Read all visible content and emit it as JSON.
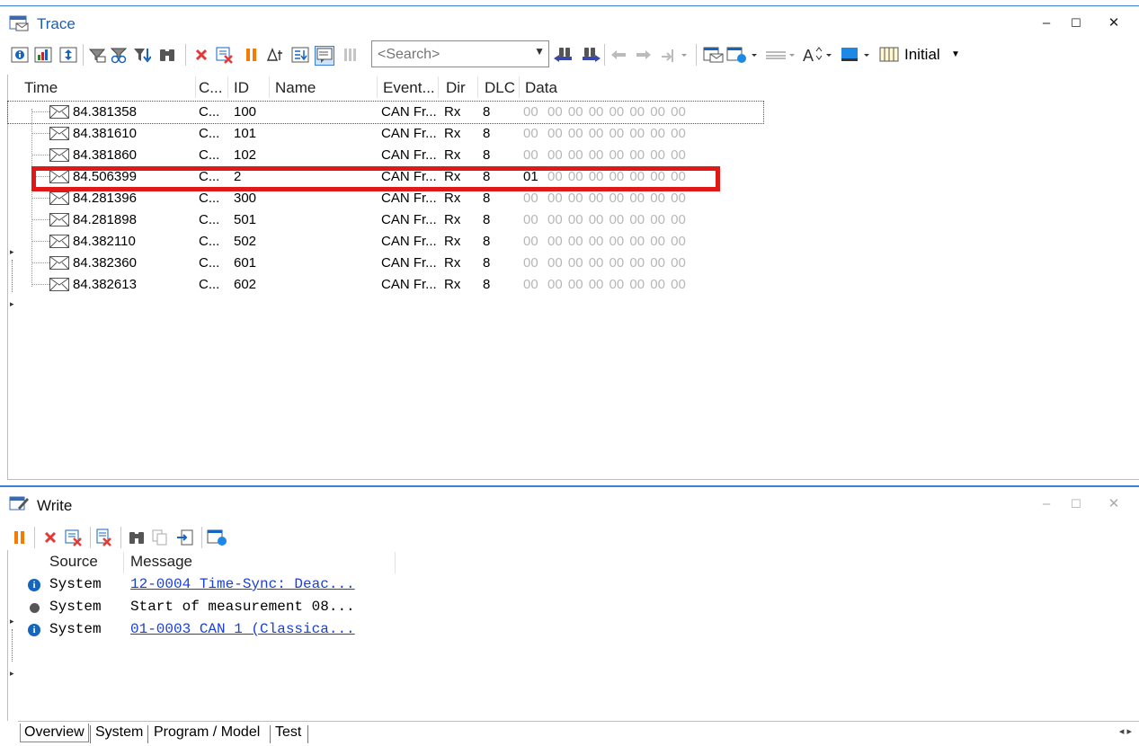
{
  "trace": {
    "title": "Trace",
    "window_controls": {
      "minimize": "–",
      "maximize": "☐",
      "close": "✕"
    },
    "search": {
      "placeholder": "<Search>"
    },
    "view": {
      "label": "Initial"
    },
    "columns": [
      "Time",
      "C...",
      "ID",
      "Name",
      "Event...",
      "Dir",
      "DLC",
      "Data"
    ],
    "rows": [
      {
        "time": "84.381358",
        "chan": "C...",
        "id": "100",
        "name": "",
        "event": "CAN Fr...",
        "dir": "Rx",
        "dlc": "8",
        "first": "00",
        "data": "00  00  00  00  00  00  00  00",
        "rest": "00  00  00  00  00  00  00"
      },
      {
        "time": "84.381610",
        "chan": "C...",
        "id": "101",
        "name": "",
        "event": "CAN Fr...",
        "dir": "Rx",
        "dlc": "8",
        "first": "00",
        "rest": "00  00  00  00  00  00  00"
      },
      {
        "time": "84.381860",
        "chan": "C...",
        "id": "102",
        "name": "",
        "event": "CAN Fr...",
        "dir": "Rx",
        "dlc": "8",
        "first": "00",
        "rest": "00  00  00  00  00  00  00"
      },
      {
        "time": "84.506399",
        "chan": "C...",
        "id": "2",
        "name": "",
        "event": "CAN Fr...",
        "dir": "Rx",
        "dlc": "8",
        "first": "01",
        "rest": "00  00  00  00  00  00  00"
      },
      {
        "time": "84.281396",
        "chan": "C...",
        "id": "300",
        "name": "",
        "event": "CAN Fr...",
        "dir": "Rx",
        "dlc": "8",
        "first": "00",
        "rest": "00  00  00  00  00  00  00"
      },
      {
        "time": "84.281898",
        "chan": "C...",
        "id": "501",
        "name": "",
        "event": "CAN Fr...",
        "dir": "Rx",
        "dlc": "8",
        "first": "00",
        "rest": "00  00  00  00  00  00  00"
      },
      {
        "time": "84.382110",
        "chan": "C...",
        "id": "502",
        "name": "",
        "event": "CAN Fr...",
        "dir": "Rx",
        "dlc": "8",
        "first": "00",
        "rest": "00  00  00  00  00  00  00"
      },
      {
        "time": "84.382360",
        "chan": "C...",
        "id": "601",
        "name": "",
        "event": "CAN Fr...",
        "dir": "Rx",
        "dlc": "8",
        "first": "00",
        "rest": "00  00  00  00  00  00  00"
      },
      {
        "time": "84.382613",
        "chan": "C...",
        "id": "602",
        "name": "",
        "event": "CAN Fr...",
        "dir": "Rx",
        "dlc": "8",
        "first": "00",
        "rest": "00  00  00  00  00  00  00"
      }
    ]
  },
  "write": {
    "title": "Write",
    "window_controls": {
      "minimize": "–",
      "maximize": "☐",
      "close": "✕"
    },
    "columns": [
      "Source",
      "Message"
    ],
    "rows": [
      {
        "icon": "info-icon",
        "source": "System",
        "message": "12-0004 Time-Sync: Deac...",
        "link": true
      },
      {
        "icon": "bullet-icon",
        "source": "System",
        "message": "Start of measurement 08...",
        "link": false
      },
      {
        "icon": "info-icon",
        "source": "System",
        "message": "01-0003 CAN 1 (Classica...",
        "link": true
      }
    ],
    "tabs": [
      "Overview",
      "System",
      "Program / Model",
      "Test"
    ],
    "scroll_arrows": "◂ ▸"
  },
  "colors": {
    "accent": "#3a7fd5",
    "highlight": "#e01818",
    "link": "#1a3fd8",
    "title": "#1a5fb4"
  }
}
